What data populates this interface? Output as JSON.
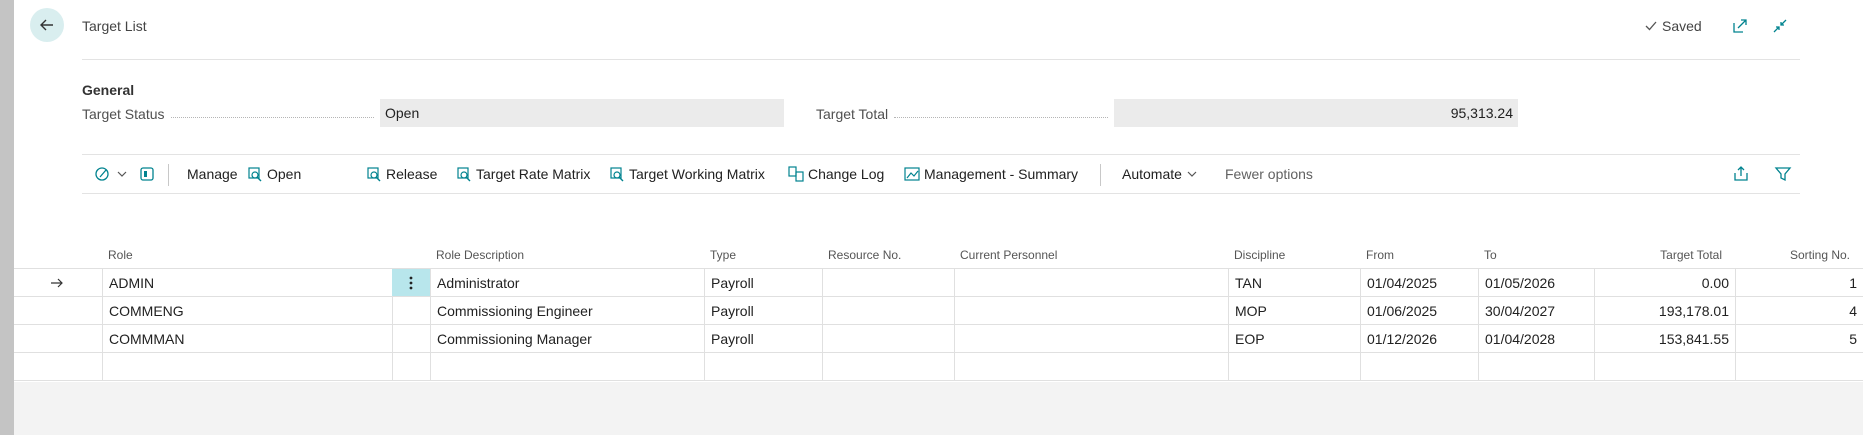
{
  "header": {
    "title": "Target List",
    "saved": "Saved"
  },
  "general": {
    "heading": "General",
    "status_label": "Target Status",
    "status_value": "Open",
    "total_label": "Target Total",
    "total_value": "95,313.24"
  },
  "toolbar": {
    "manage": "Manage",
    "open": "Open",
    "release": "Release",
    "rate_matrix": "Target Rate Matrix",
    "working_matrix": "Target Working Matrix",
    "change_log": "Change Log",
    "mgmt_summary": "Management - Summary",
    "automate": "Automate",
    "fewer": "Fewer options"
  },
  "table": {
    "columns": [
      "Role",
      "Role Description",
      "Type",
      "Resource No.",
      "Current Personnel",
      "Discipline",
      "From",
      "To",
      "Target Total",
      "Sorting No."
    ],
    "rows": [
      [
        "ADMIN",
        "Administrator",
        "Payroll",
        "",
        "",
        "TAN",
        "01/04/2025",
        "01/05/2026",
        "0.00",
        "1"
      ],
      [
        "COMMENG",
        "Commissioning Engineer",
        "Payroll",
        "",
        "",
        "MOP",
        "01/06/2025",
        "30/04/2027",
        "193,178.01",
        "4"
      ],
      [
        "COMMMAN",
        "Commissioning Manager",
        "Payroll",
        "",
        "",
        "EOP",
        "01/12/2026",
        "01/04/2028",
        "153,841.55",
        "5"
      ],
      [
        "",
        "",
        "",
        "",
        "",
        "",
        "",
        "",
        "",
        ""
      ]
    ]
  },
  "colors": {
    "accent": "#00838f",
    "selected_cell": "#b8e6ec",
    "back_button": "#d9eeef"
  }
}
